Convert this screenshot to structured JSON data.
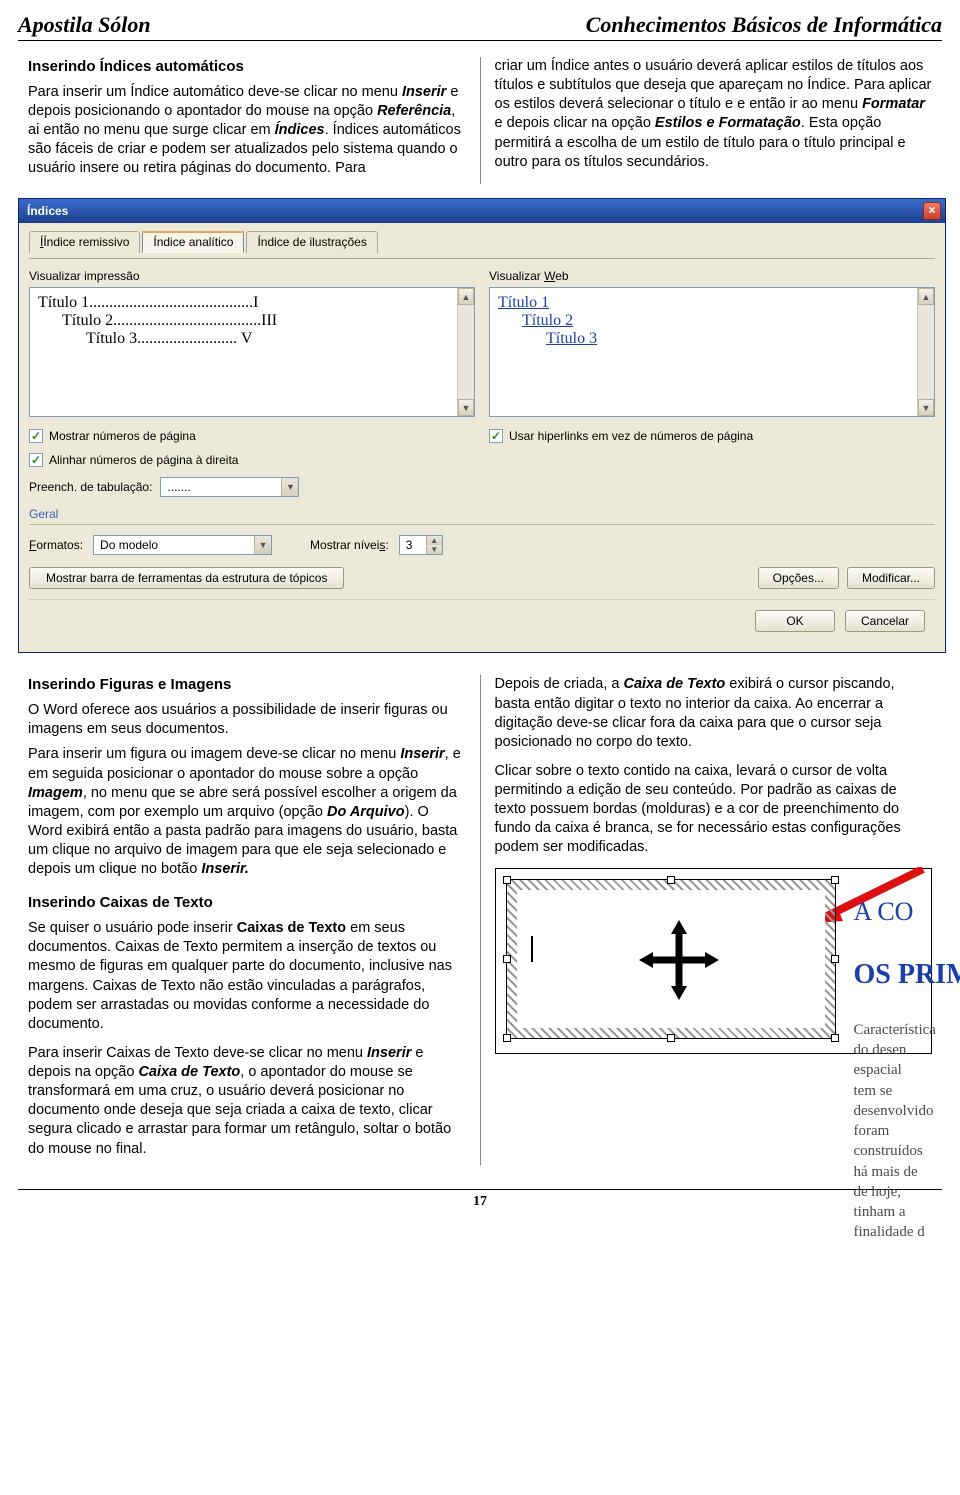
{
  "header": {
    "left": "Apostila Sólon",
    "right": "Conhecimentos Básicos de Informática"
  },
  "sec1": {
    "title": "Inserindo Índices automáticos",
    "left": {
      "p1a": "Para inserir um Índice automático deve-se clicar no menu ",
      "p1b": "Inserir",
      "p1c": " e depois posicionando o apontador do mouse na opção ",
      "p1d": "Referência",
      "p1e": ", ai então no menu que surge clicar em ",
      "p1f": "Índices",
      "p1g": ". Índices automáticos são fáceis de criar e podem ser atualizados pelo sistema quando o usuário insere ou retira páginas do documento. Para"
    },
    "right": {
      "p1a": "criar um Índice antes o usuário deverá aplicar estilos de títulos aos títulos e subtítulos que deseja que apareçam no Índice. Para aplicar os estilos deverá selecionar o título e e então ir ao menu ",
      "p1b": "Formatar",
      "p1c": " e depois clicar na opção ",
      "p1d": "Estilos e Formatação",
      "p1e": ". Esta opção permitirá a escolha de um estilo de título para o título principal e outro para os títulos secundários."
    }
  },
  "dialog": {
    "title": "Índices",
    "tabs": {
      "t1": "Índice remissivo",
      "t2": "Índice analítico",
      "t3": "Índice de ilustrações"
    },
    "prevPrint": "Visualizar impressão",
    "prevWeb": "Visualizar Web",
    "print": {
      "l1": "Título 1.........................................I",
      "l2": "Título 2.....................................III",
      "l3": "Título 3......................... V"
    },
    "web": {
      "l1": "Título 1",
      "l2": "Título 2",
      "l3": "Título 3"
    },
    "chk1": "Mostrar números de página",
    "chk2": "Alinhar números de página à direita",
    "chk3": "Usar hiperlinks em vez de números de página",
    "tabFillLbl": "Preench. de tabulação:",
    "tabFillVal": ".......",
    "geral": "Geral",
    "formatsLbl": "Formatos:",
    "formatsVal": "Do modelo",
    "levelsLbl": "Mostrar níveis:",
    "levelsVal": "3",
    "outlineBtn": "Mostrar barra de ferramentas da estrutura de tópicos",
    "optionsBtn": "Opções...",
    "modifyBtn": "Modificar...",
    "ok": "OK",
    "cancel": "Cancelar"
  },
  "sec2": {
    "title": "Inserindo Figuras e Imagens",
    "p1": "O Word oferece aos usuários a possibilidade de inserir figuras ou imagens em seus documentos.",
    "p2a": "Para inserir um figura ou imagem deve-se clicar no menu ",
    "p2b": "Inserir",
    "p2c": ", e em seguida posicionar o apontador do mouse sobre a opção ",
    "p2d": "Imagem",
    "p2e": ", no menu que se abre será possível escolher a origem da imagem, com por exemplo um arquivo (opção ",
    "p2f": "Do Arquivo",
    "p2g": "). O Word exibirá então a pasta padrão para imagens do usuário, basta um clique no arquivo de imagem para que ele seja selecionado e depois um clique no botão ",
    "p2h": "Inserir."
  },
  "sec3": {
    "title": "Inserindo Caixas de Texto",
    "p1a": "Se quiser o usuário pode inserir ",
    "p1b": "Caixas de Texto",
    "p1c": " em seus documentos. Caixas de Texto permitem a inserção de textos ou mesmo de figuras em qualquer parte do documento, inclusive nas margens. Caixas de Texto não estão vinculadas a parágrafos, podem ser arrastadas ou movidas conforme  a necessidade do documento.",
    "p2a": "Para inserir Caixas de Texto deve-se clicar no menu ",
    "p2b": "Inserir",
    "p2c": " e depois na opção ",
    "p2d": "Caixa de Texto",
    "p2e": ", o apontador do mouse se transformará em uma cruz, o usuário deverá posicionar no documento onde deseja que seja criada a caixa de texto, clicar segura clicado e arrastar para formar um retângulo, soltar o botão do mouse no final."
  },
  "sec4": {
    "p1a": "Depois de criada, a ",
    "p1b": "Caixa de Texto",
    "p1c": " exibirá o cursor piscando, basta então digitar o texto no interior da caixa. Ao encerrar a digitação deve-se clicar fora da caixa para que o cursor seja posicionado no corpo do texto.",
    "p2": "Clicar sobre o texto contido na caixa, levará o cursor de volta permitindo a edição de seu conteúdo. Por padrão as caixas de texto possuem bordas (molduras) e  a cor de preenchimento do fundo da caixa é branca, se for necessário estas configurações podem ser modificadas."
  },
  "illus": {
    "t1": "A CO",
    "t2": "OS PRIMEIROS FO",
    "s1": "Característica do desen",
    "s2": "espacial tem se desenvolvido",
    "s3": "foram construídos há mais de",
    "s4": "de hoje, tinham a finalidade d"
  },
  "pageNum": "17"
}
